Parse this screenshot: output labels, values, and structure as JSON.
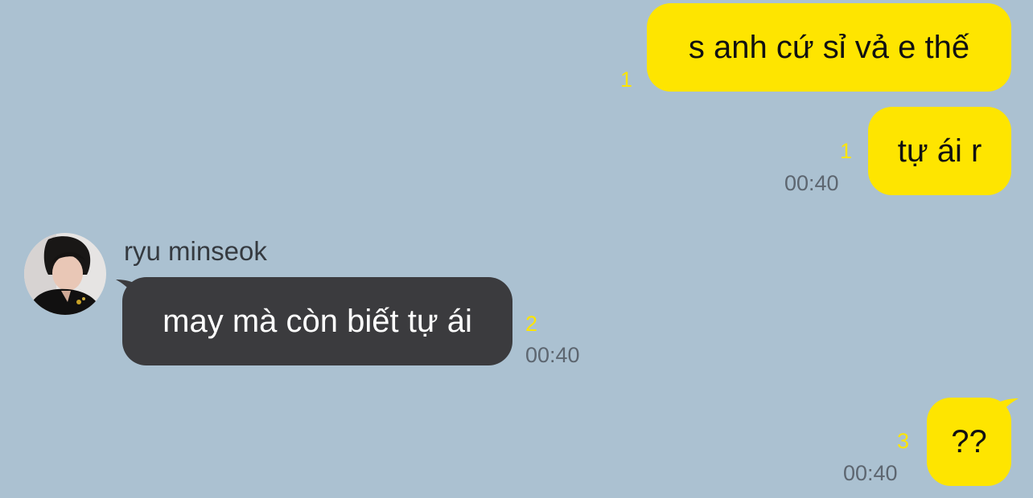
{
  "chat": {
    "colors": {
      "background": "#abc1d1",
      "outgoing_bubble": "#fee500",
      "incoming_bubble": "#3b3b3e",
      "unread_count": "#fee500",
      "timestamp": "#5d6670"
    },
    "messages": [
      {
        "direction": "outgoing",
        "text": "s anh cứ sỉ vả e thế",
        "unread": "1",
        "time": ""
      },
      {
        "direction": "outgoing",
        "text": "tự ái r",
        "unread": "1",
        "time": "00:40"
      },
      {
        "direction": "incoming",
        "sender": "ryu minseok",
        "avatar": "profile-photo",
        "text": "may mà còn biết tự ái",
        "unread": "2",
        "time": "00:40"
      },
      {
        "direction": "outgoing",
        "text": "??",
        "unread": "3",
        "time": "00:40"
      }
    ]
  }
}
